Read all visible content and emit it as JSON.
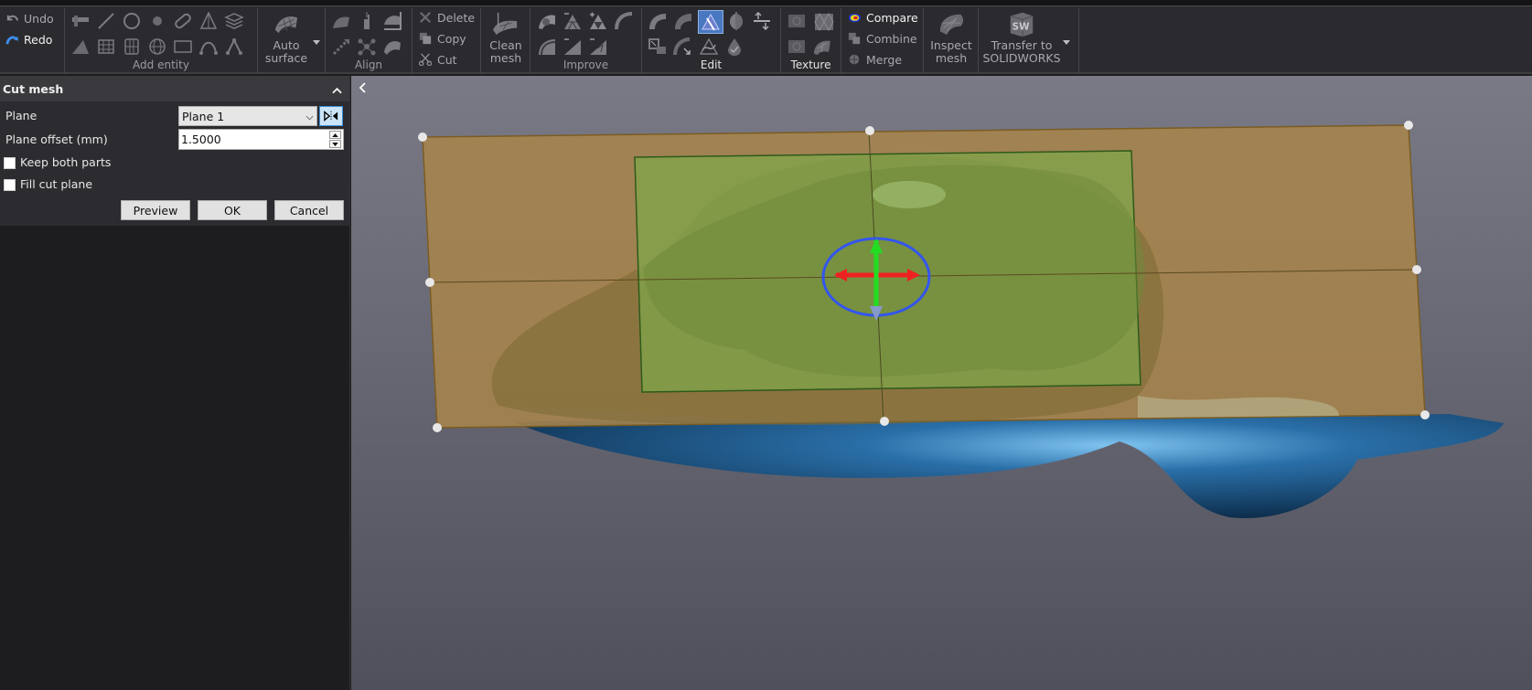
{
  "ribbon": {
    "undo_label": "Undo",
    "redo_label": "Redo",
    "groups": {
      "add_entity": "Add entity",
      "align": "Align",
      "improve": "Improve",
      "edit": "Edit",
      "texture": "Texture"
    },
    "auto_surface": [
      "Auto",
      "surface"
    ],
    "delete_label": "Delete",
    "copy_label": "Copy",
    "cut_label": "Cut",
    "clean_mesh": [
      "Clean",
      "mesh"
    ],
    "compare_label": "Compare",
    "combine_label": "Combine",
    "merge_label": "Merge",
    "inspect_mesh": [
      "Inspect",
      "mesh"
    ],
    "transfer": [
      "Transfer to",
      "SOLIDWORKS"
    ],
    "sw_logo_text": "SW"
  },
  "panel": {
    "title": "Cut mesh",
    "plane_label": "Plane",
    "plane_value": "Plane 1",
    "offset_label": "Plane offset (mm)",
    "offset_value": "1.5000",
    "keep_both_parts": {
      "label": "Keep both parts",
      "checked": false
    },
    "fill_cut_plane": {
      "label": "Fill cut plane",
      "checked": false
    },
    "preview_label": "Preview",
    "ok_label": "OK",
    "cancel_label": "Cancel"
  },
  "viewport": {
    "collapse_icon": "chevron-left-icon",
    "colors": {
      "cut_plane": "#a7844c",
      "selection_rect": "#7ea84a",
      "mesh_lower": "#1e5a8a",
      "gizmo_ring": "#3355ee",
      "gizmo_x": "#ee2222",
      "gizmo_y": "#22dd22"
    }
  }
}
